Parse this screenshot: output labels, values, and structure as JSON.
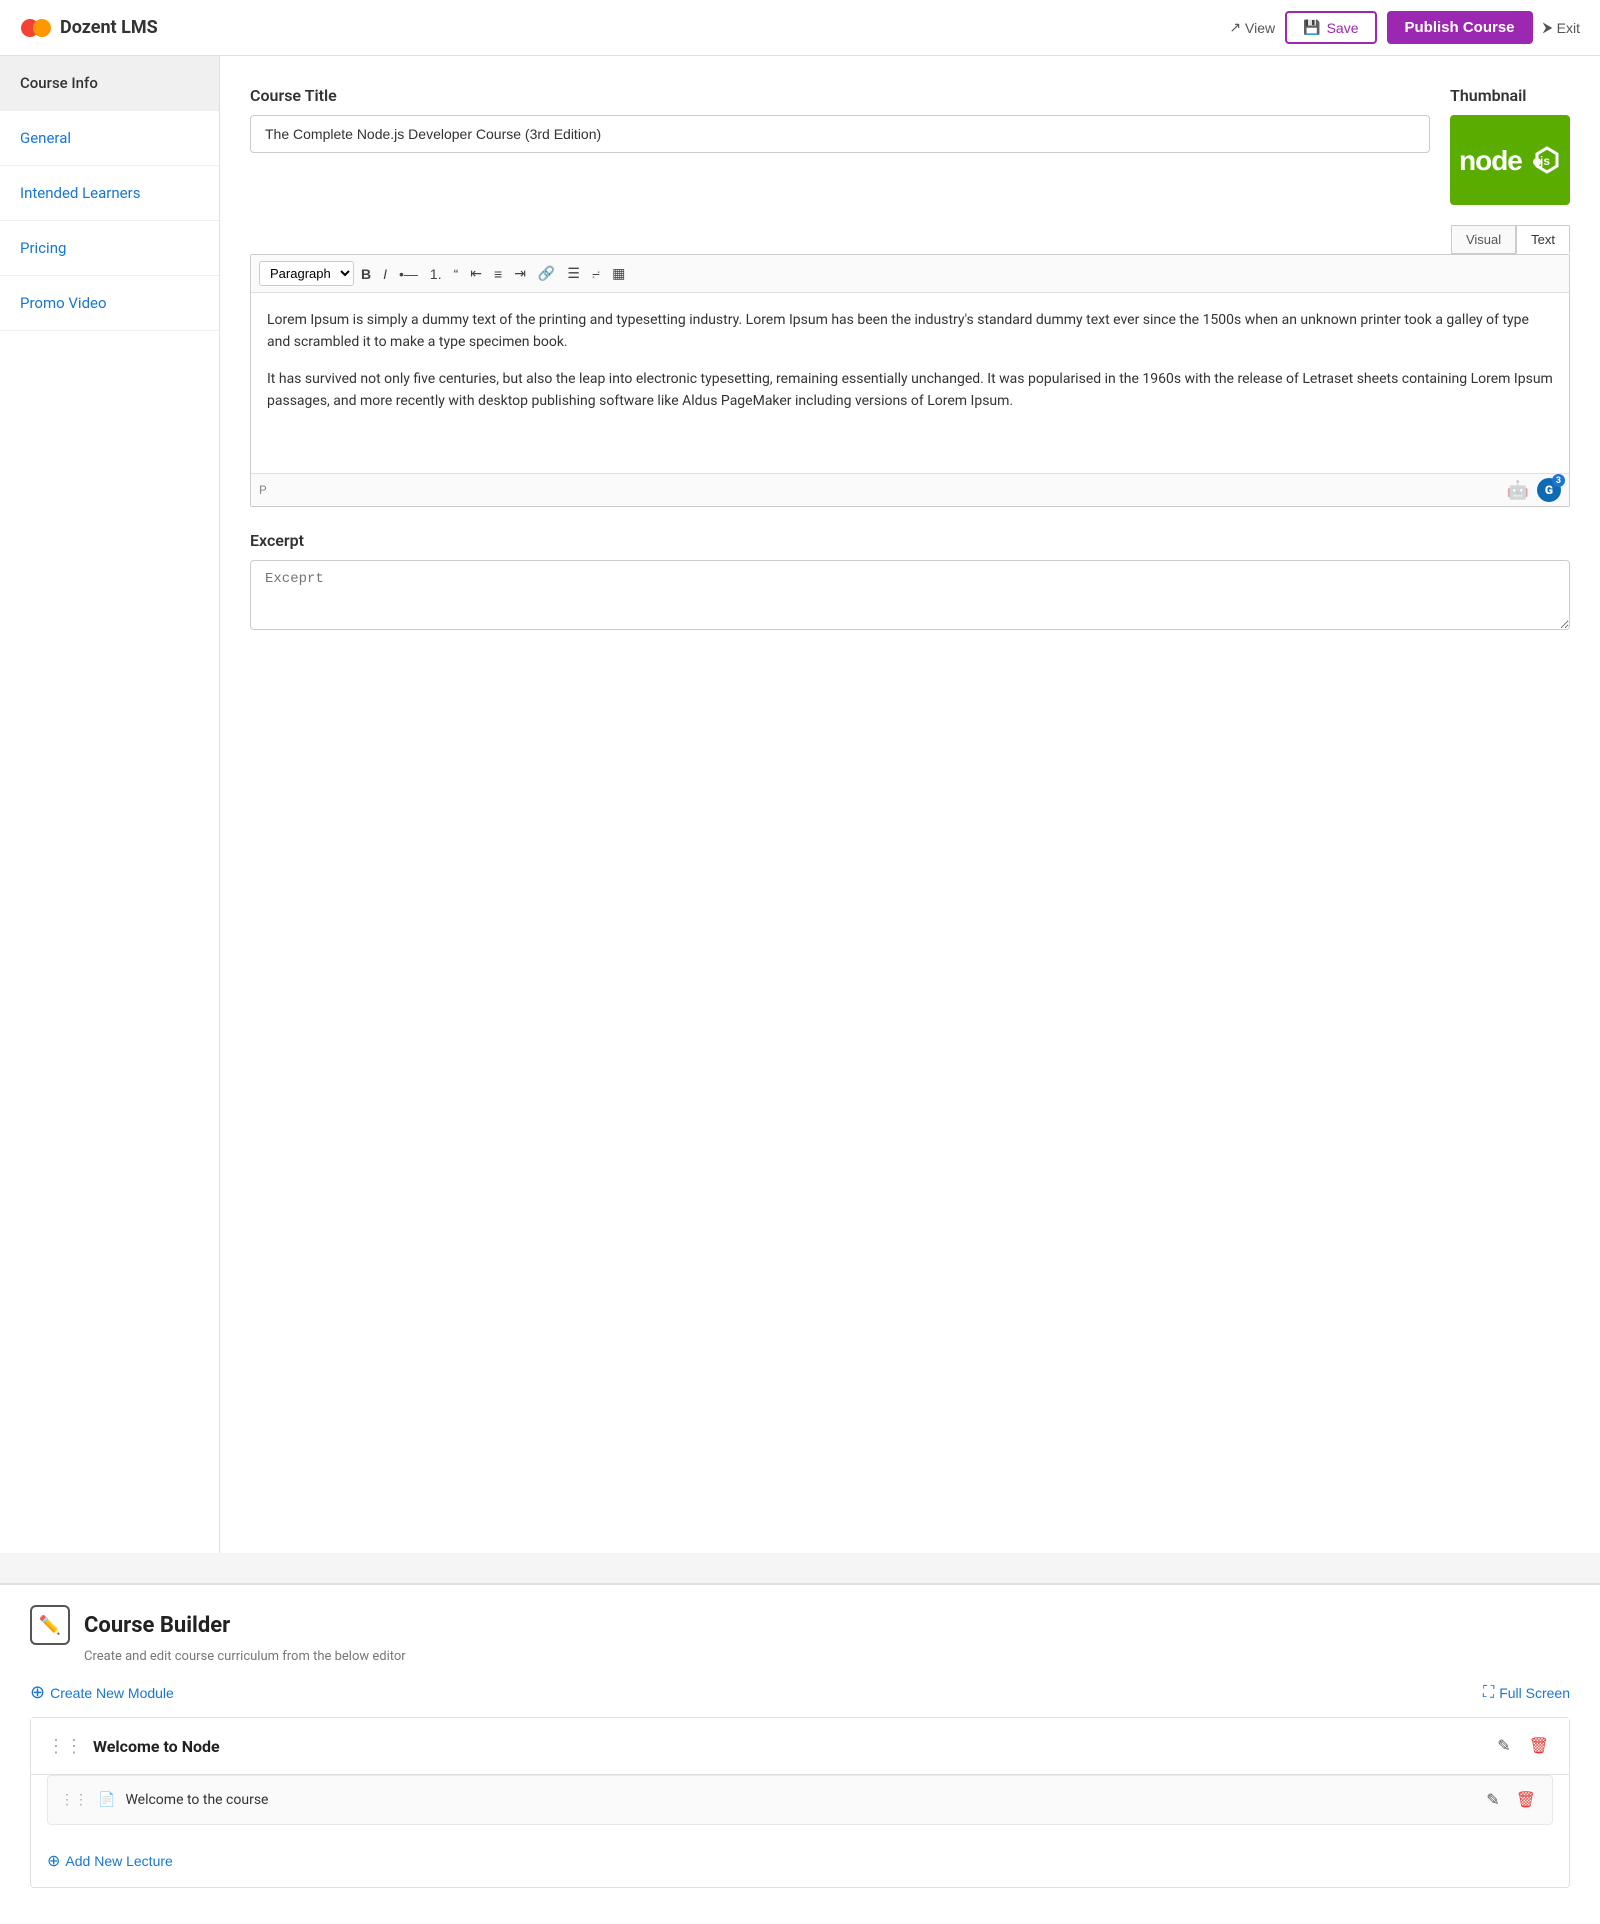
{
  "header": {
    "logo_text": "Dozent LMS",
    "view_label": "View",
    "save_label": "Save",
    "publish_label": "Publish Course",
    "exit_label": "Exit"
  },
  "sidebar": {
    "items": [
      {
        "id": "course-info",
        "label": "Course Info",
        "active": true,
        "link": false
      },
      {
        "id": "general",
        "label": "General",
        "active": false,
        "link": true
      },
      {
        "id": "intended-learners",
        "label": "Intended Learners",
        "active": false,
        "link": true
      },
      {
        "id": "pricing",
        "label": "Pricing",
        "active": false,
        "link": true
      },
      {
        "id": "promo-video",
        "label": "Promo Video",
        "active": false,
        "link": true
      }
    ]
  },
  "course_title": {
    "label": "Course Title",
    "value": "The Complete Node.js Developer Course (3rd Edition)",
    "placeholder": "Course Title"
  },
  "thumbnail": {
    "label": "Thumbnail"
  },
  "editor": {
    "tab_visual": "Visual",
    "tab_text": "Text",
    "paragraph_label": "Paragraph",
    "toolbar_buttons": [
      "B",
      "I",
      "ul",
      "ol",
      "❝",
      "≡l",
      "≡c",
      "≡r",
      "🔗",
      "▤",
      "⤢",
      "▦"
    ],
    "paragraph_tag": "P",
    "body_paragraphs": [
      "Lorem Ipsum is simply a dummy text of the printing and typesetting industry. Lorem Ipsum has been the industry's standard dummy text ever since the 1500s when an unknown printer took a galley of type and scrambled it to make a type specimen book.",
      "It has survived not only five centuries, but also the leap into electronic typesetting, remaining essentially unchanged. It was popularised in the 1960s with the release of Letraset sheets containing Lorem Ipsum passages, and more recently with desktop publishing software like Aldus PageMaker including versions of Lorem Ipsum."
    ]
  },
  "excerpt": {
    "label": "Excerpt",
    "placeholder": "Exceprt"
  },
  "builder": {
    "title": "Course Builder",
    "subtitle": "Create and edit course curriculum from the below editor",
    "create_module_label": "Create New Module",
    "fullscreen_label": "Full Screen",
    "modules": [
      {
        "id": "module-1",
        "title": "Welcome to Node",
        "lectures": [
          {
            "id": "lecture-1",
            "title": "Welcome to the course"
          }
        ]
      }
    ],
    "add_lecture_label": "Add New Lecture"
  }
}
